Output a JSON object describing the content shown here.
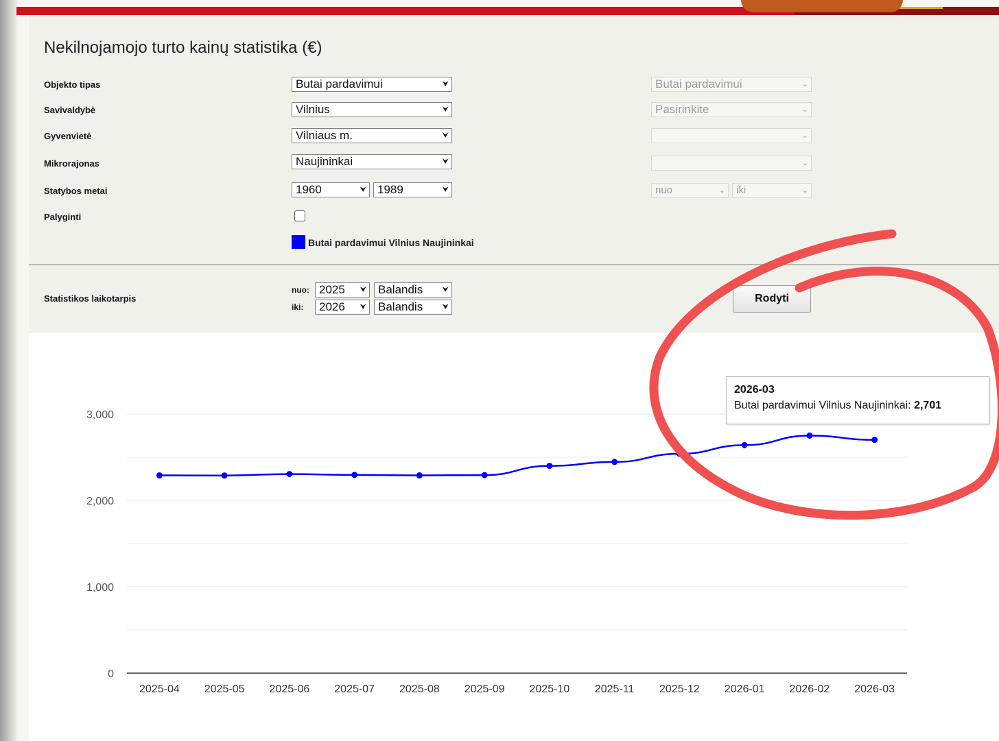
{
  "page": {
    "title": "Nekilnojamojo turto kainų statistika (€)"
  },
  "form": {
    "rows": [
      {
        "label": "Objekto tipas",
        "value": "Butai pardavimui",
        "compare_value": "Butai pardavimui"
      },
      {
        "label": "Savivaldybė",
        "value": "Vilnius",
        "compare_value": "Pasirinkite"
      },
      {
        "label": "Gyvenvietė",
        "value": "Vilniaus m.",
        "compare_value": ""
      },
      {
        "label": "Mikrorajonas",
        "value": "Naujininkai",
        "compare_value": ""
      }
    ],
    "build_years": {
      "label": "Statybos metai",
      "from": "1960",
      "to": "1989",
      "compare_from": "nuo",
      "compare_to": "iki"
    },
    "compare": {
      "label": "Palyginti",
      "checked": false
    },
    "legend": {
      "label": "Butai pardavimui Vilnius Naujininkai",
      "color": "#0000ff"
    }
  },
  "period": {
    "label": "Statistikos laikotarpis",
    "from_label": "nuo:",
    "to_label": "iki:",
    "from_year": "2025",
    "from_month": "Balandis",
    "to_year": "2026",
    "to_month": "Balandis",
    "button": "Rodyti"
  },
  "tooltip": {
    "date": "2026-03",
    "series": "Butai pardavimui Vilnius Naujininkai:",
    "value": "2,701"
  },
  "chart_data": {
    "type": "line",
    "categories": [
      "2025-04",
      "2025-05",
      "2025-06",
      "2025-07",
      "2025-08",
      "2025-09",
      "2025-10",
      "2025-11",
      "2025-12",
      "2026-01",
      "2026-02",
      "2026-03"
    ],
    "series": [
      {
        "name": "Butai pardavimui Vilnius Naujininkai",
        "color": "#0000ff",
        "values": [
          2290,
          2288,
          2305,
          2295,
          2290,
          2293,
          2400,
          2445,
          2540,
          2640,
          2750,
          2701
        ]
      }
    ],
    "ylim": [
      0,
      3000
    ],
    "yticks": [
      0,
      1000,
      2000,
      3000
    ],
    "ytick_labels": [
      "0",
      "1,000",
      "2,000",
      "3,000"
    ],
    "grid": true
  },
  "annotation": {
    "color": "#f05050",
    "shape": "hand-drawn circle"
  }
}
